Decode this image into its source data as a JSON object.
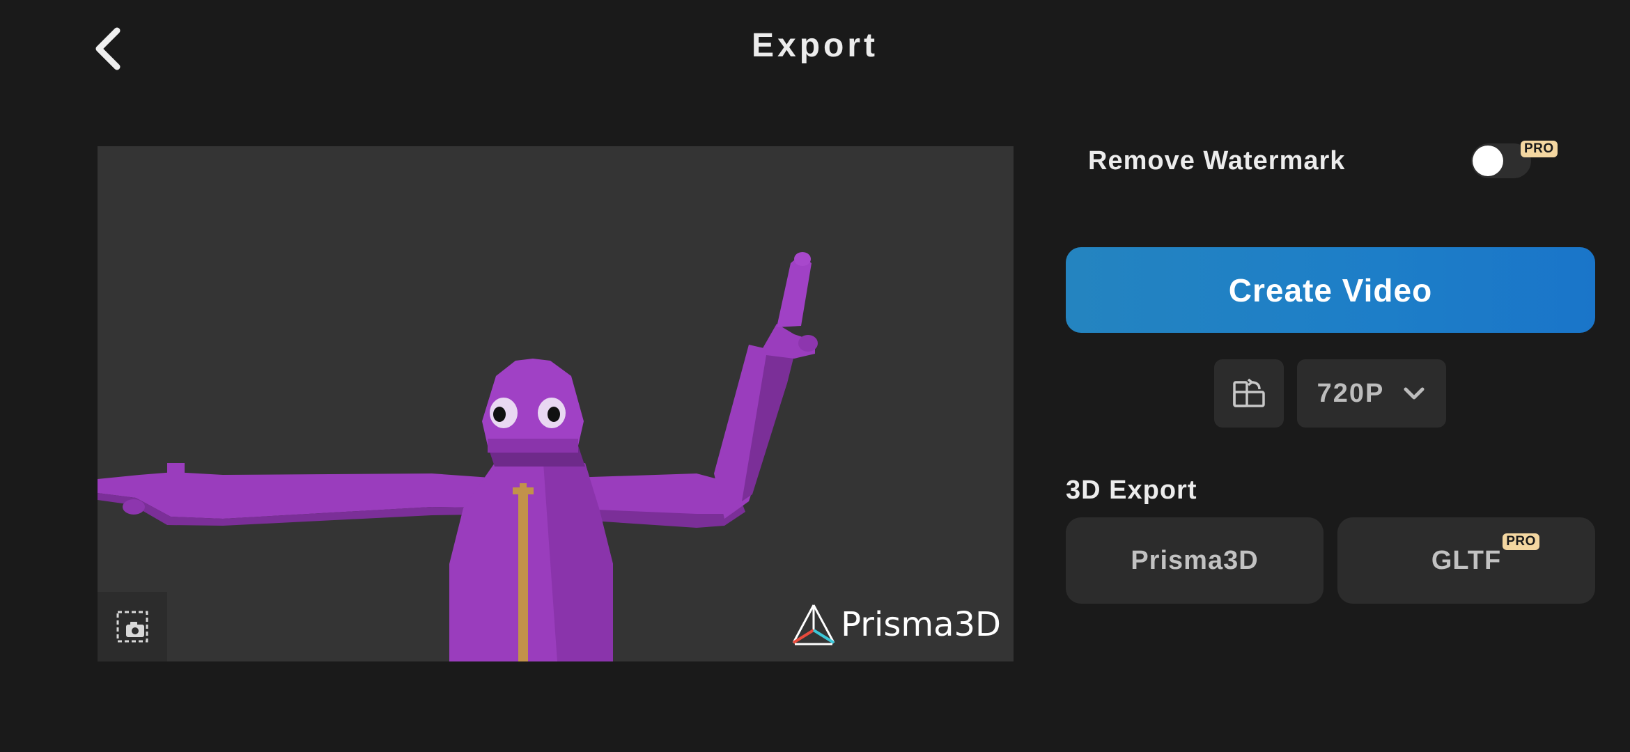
{
  "header": {
    "title": "Export",
    "back_icon": "chevron-left-icon"
  },
  "preview": {
    "background": "#343434",
    "character_color": "#9b3cbf",
    "snapshot_icon": "screenshot-camera-icon",
    "watermark_text": "Prisma3D",
    "watermark_icon": "prisma3d-logo-icon"
  },
  "watermark_setting": {
    "label": "Remove Watermark",
    "enabled": false,
    "badge": "PRO"
  },
  "create_video": {
    "label": "Create Video",
    "color": "#1d7ec8"
  },
  "video_options": {
    "orientation_icon": "orientation-rotate-icon",
    "resolution": "720P",
    "dropdown_icon": "chevron-down-icon"
  },
  "export_3d": {
    "heading": "3D Export",
    "options": [
      {
        "label": "Prisma3D",
        "badge": ""
      },
      {
        "label": "GLTF",
        "badge": "PRO"
      }
    ]
  },
  "colors": {
    "background": "#1a1a1a",
    "card": "#2c2c2c",
    "pro_badge": "#f4d7a1"
  }
}
